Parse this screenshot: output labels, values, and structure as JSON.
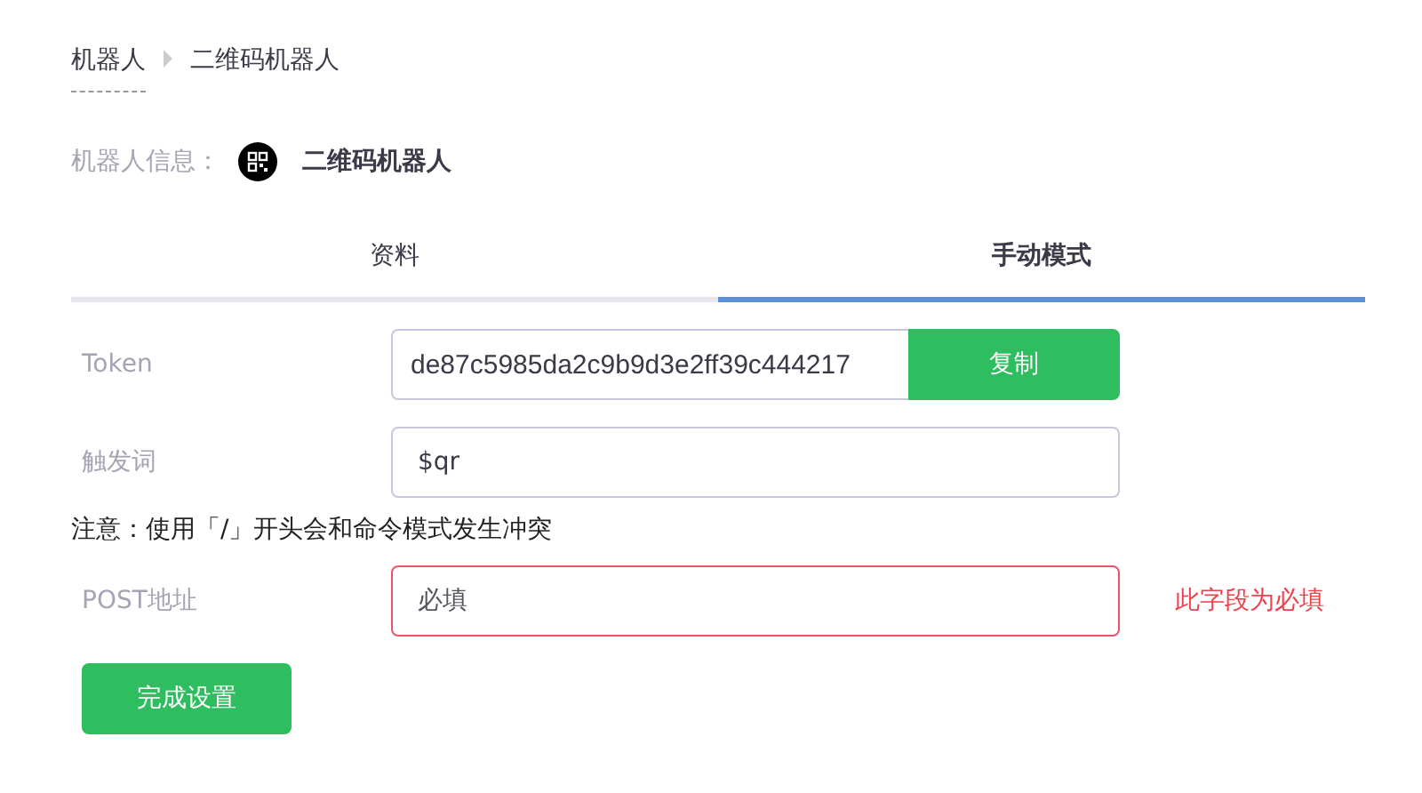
{
  "breadcrumb": [
    {
      "label": "机器人"
    },
    {
      "label": "二维码机器人"
    }
  ],
  "robot_info": {
    "label": "机器人信息：",
    "name": "二维码机器人"
  },
  "tabs": [
    {
      "label": "资料",
      "selected": false
    },
    {
      "label": "手动模式",
      "selected": true
    }
  ],
  "form": [
    {
      "kind": "copy",
      "label": "Token",
      "value": "de87c5985da2c9b9d3e2ff39c444217",
      "button": "复制",
      "invalid": false
    },
    {
      "kind": "text",
      "label": "触发词",
      "value": "$qr",
      "invalid": false
    },
    {
      "kind": "note",
      "text": "注意：使用「/」开头会和命令模式发生冲突"
    },
    {
      "kind": "text",
      "label": "POST地址",
      "placeholder": "必填",
      "invalid": true,
      "error": "此字段为必填"
    }
  ],
  "submit": "完成设置"
}
